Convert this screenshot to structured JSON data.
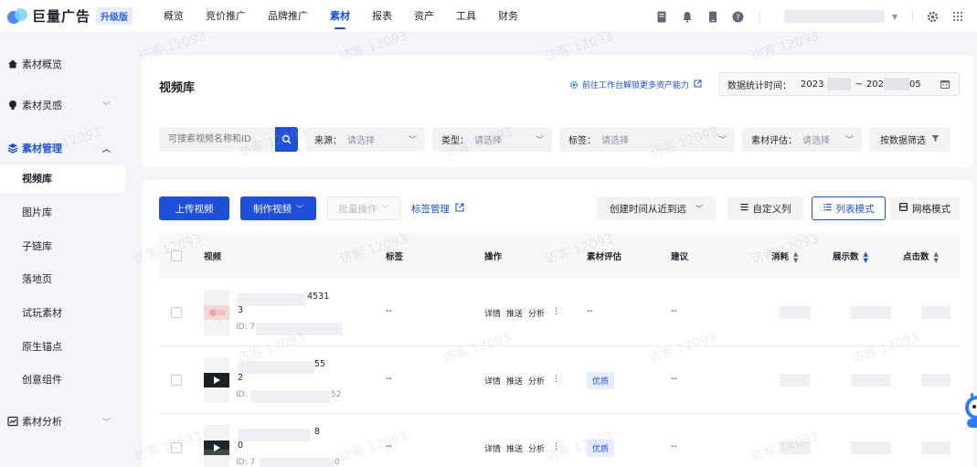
{
  "brand": {
    "name": "巨量广告",
    "edition": "升级版"
  },
  "topnav": {
    "items": [
      {
        "label": "概览"
      },
      {
        "label": "竞价推广"
      },
      {
        "label": "品牌推广"
      },
      {
        "label": "素材"
      },
      {
        "label": "报表"
      },
      {
        "label": "资产"
      },
      {
        "label": "工具"
      },
      {
        "label": "财务"
      }
    ],
    "active_index": 3
  },
  "sidebar": {
    "groups": [
      {
        "label": "素材概览",
        "icon": "home-icon"
      },
      {
        "label": "素材灵感",
        "icon": "bulb-icon"
      },
      {
        "label": "素材管理",
        "icon": "layers-icon"
      },
      {
        "label": "素材分析",
        "icon": "chart-icon"
      }
    ],
    "sub_items": [
      "视频库",
      "图片库",
      "子链库",
      "落地页",
      "试玩素材",
      "原生锚点",
      "创意组件"
    ],
    "active_sub": "视频库"
  },
  "header": {
    "title": "视频库",
    "promo_link": "前往工作台解锁更多资产能力",
    "date_label": "数据统计时间：",
    "date_start": "2023",
    "date_sep": "~",
    "date_end_prefix": "202",
    "date_end_suffix": "05"
  },
  "filters": {
    "search_placeholder": "可搜索视频名称和ID",
    "source": {
      "label": "来源：",
      "value": "请选择"
    },
    "type": {
      "label": "类型：",
      "value": "请选择"
    },
    "tag": {
      "label": "标签：",
      "value": "请选择"
    },
    "eval": {
      "label": "素材评估：",
      "value": "请选择"
    },
    "data_filter": "按数据筛选"
  },
  "toolbar": {
    "upload": "上传视频",
    "make": "制作视频",
    "batch": "批量操作",
    "tag_manage": "标签管理",
    "sort": "创建时间从近到远",
    "custom_cols": "自定义列",
    "list_mode": "列表模式",
    "grid_mode": "网格模式"
  },
  "table": {
    "columns": {
      "video": "视频",
      "tag": "标签",
      "ops": "操作",
      "eval": "素材评估",
      "advice": "建议",
      "cost": "消耗",
      "impressions": "展示数",
      "clicks": "点击数"
    },
    "op_labels": {
      "detail": "详情",
      "push": "推送",
      "analyze": "分析",
      "more": "⋮"
    },
    "rows": [
      {
        "title_end": "4531",
        "sub": "3",
        "id_label": "ID: 7",
        "id_end": "",
        "tag": "--",
        "eval": "--",
        "badge": "",
        "advice": "--"
      },
      {
        "title_end": "55",
        "sub": "2",
        "id_label": "ID:",
        "id_end": "52",
        "tag": "--",
        "eval": "",
        "badge": "优质",
        "advice": "--"
      },
      {
        "title_end": "8",
        "sub": "0",
        "id_label": "ID: 7",
        "id_end": "0",
        "tag": "--",
        "eval": "",
        "badge": "优质",
        "advice": "--"
      }
    ]
  },
  "watermark": "访客 12093"
}
